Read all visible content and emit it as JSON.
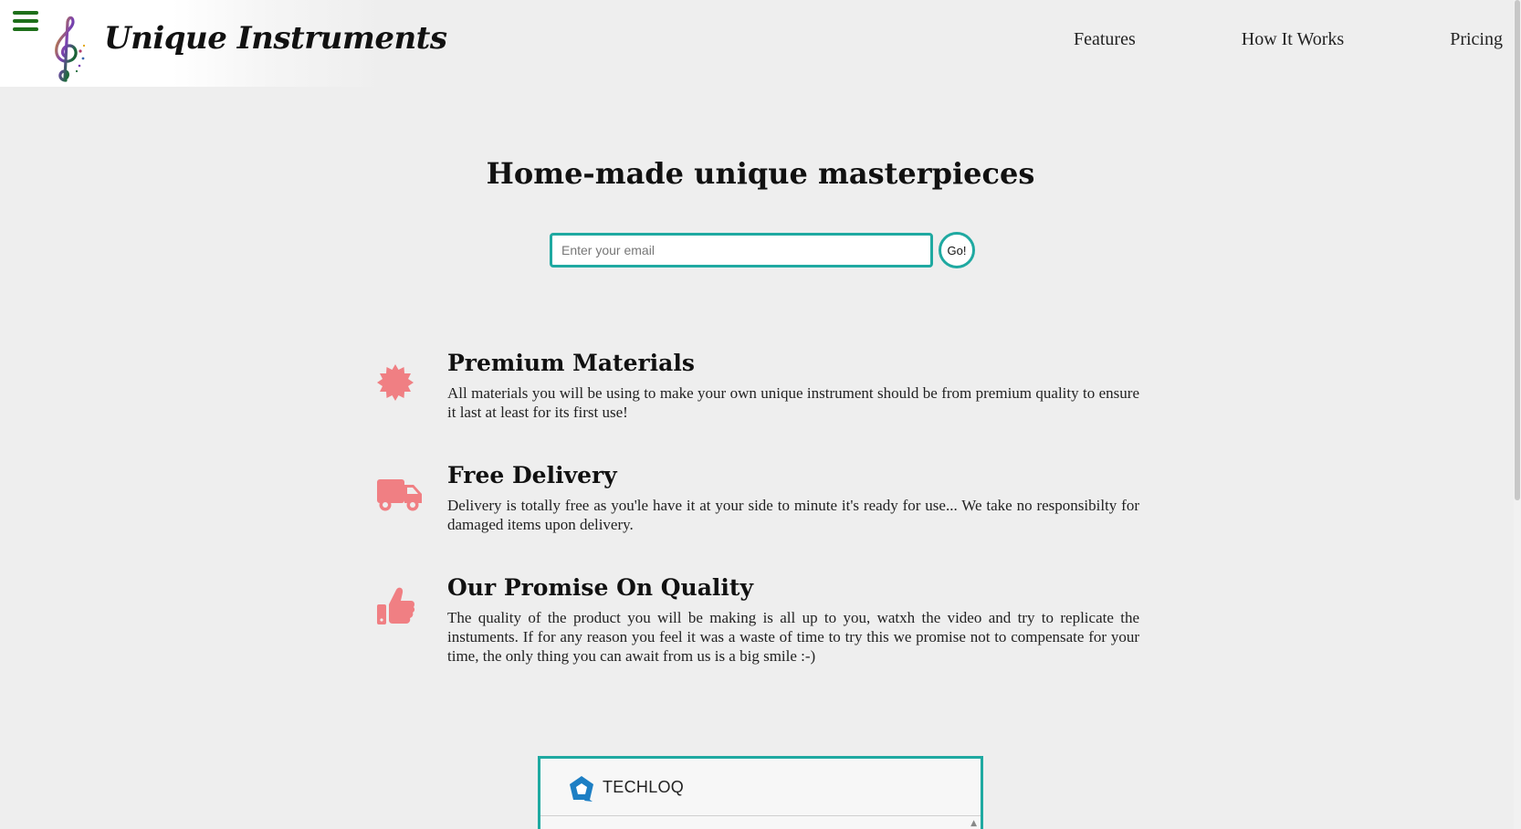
{
  "header": {
    "brand_name": "Unique Instruments",
    "nav": [
      {
        "label": "Features"
      },
      {
        "label": "How It Works"
      },
      {
        "label": "Pricing"
      }
    ]
  },
  "hero": {
    "title": "Home-made unique masterpieces",
    "email_placeholder": "Enter your email",
    "submit_label": "Go!"
  },
  "features": [
    {
      "icon": "badge-icon",
      "title": "Premium Materials",
      "description": "All materials you will be using to make your own unique instrument should be from premium quality to ensure it last at least for its first use!"
    },
    {
      "icon": "truck-icon",
      "title": "Free Delivery",
      "description": "Delivery is totally free as you'le have it at your side to minute it's ready for use... We take no responsibilty for damaged items upon delivery."
    },
    {
      "icon": "thumbs-up-icon",
      "title": "Our Promise On Quality",
      "description": "The quality of the product you will be making is all up to you, watxh the video and try to replicate the instuments. If for any reason you feel it was a waste of time to try this we promise not to compensate for your time, the only thing you can await from us is a big smile :-)"
    }
  ],
  "video": {
    "channel_name": "TECHLOQ"
  },
  "colors": {
    "accent": "#1fa9a1",
    "icon": "#f07f83",
    "menu": "#1e6f1a",
    "background": "#eeeeee"
  }
}
